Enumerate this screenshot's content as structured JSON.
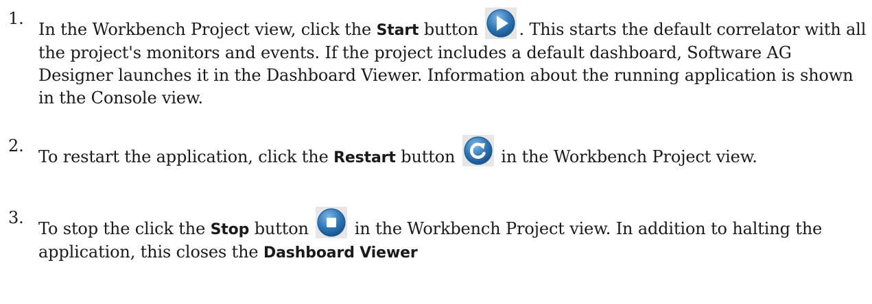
{
  "steps": [
    {
      "number": "1.",
      "text_before": "In the Workbench Project view, click the ",
      "button_name": "Start",
      "text_mid": " button ",
      "icon": "play-icon",
      "text_after": ". This starts the default correlator with all the project's monitors and events. If the project includes a default dashboard, Software AG Designer launches it in the Dashboard Viewer. Information about the running application is shown in the Console view."
    },
    {
      "number": "2.",
      "text_before": "To restart the application, click the ",
      "button_name": "Restart",
      "text_mid": " button ",
      "icon": "restart-icon",
      "text_after": " in the Workbench Project view."
    },
    {
      "number": "3.",
      "text_before": "To stop the click the ",
      "button_name": "Stop",
      "text_mid": " button ",
      "icon": "stop-icon",
      "text_after": " in the Workbench Project view. In addition to halting the application, this closes the ",
      "trailing_ui": "Dashboard Viewer"
    }
  ],
  "colors": {
    "icon_blue": "#2f78b8",
    "icon_background": "#e6e6e6",
    "text": "#1a1a1a"
  }
}
